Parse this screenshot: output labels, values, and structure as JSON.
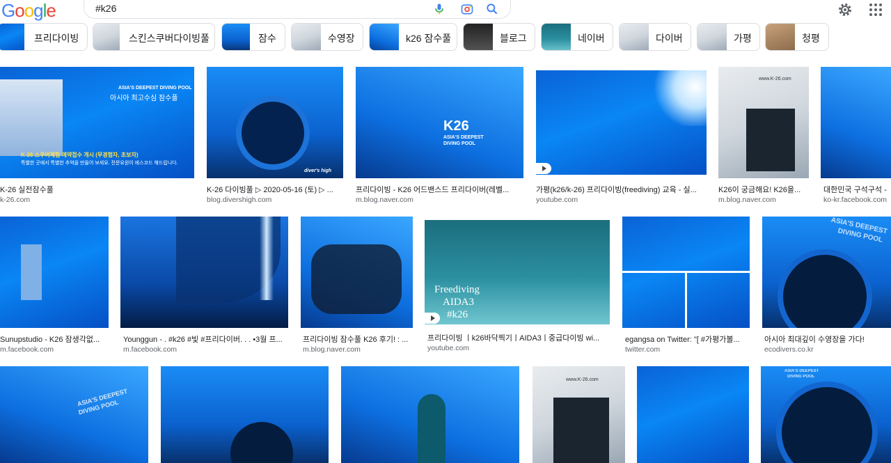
{
  "header": {
    "logo": [
      "G",
      "o",
      "o",
      "g",
      "l",
      "e"
    ],
    "logo_colors": [
      "#4285F4",
      "#EA4335",
      "#FBBC05",
      "#4285F4",
      "#34A853",
      "#EA4335"
    ],
    "query": "#k26",
    "mic_icon": "mic-icon",
    "lens_icon": "camera-lens-icon",
    "search_icon": "search-icon",
    "settings_icon": "gear-icon",
    "apps_icon": "apps-grid-icon"
  },
  "chips": [
    {
      "label": "프리다이빙"
    },
    {
      "label": "스킨스쿠버다이빙풀"
    },
    {
      "label": "잠수"
    },
    {
      "label": "수영장"
    },
    {
      "label": "k26 잠수풀"
    },
    {
      "label": "블로그"
    },
    {
      "label": "네이버"
    },
    {
      "label": "다이버"
    },
    {
      "label": "가평"
    },
    {
      "label": "청평"
    }
  ],
  "results": {
    "row1": [
      {
        "title": "K-26 실전잠수풀",
        "source": "k-26.com",
        "overlay": [
          "ASIA'S DEEPEST DIVING POOL",
          "아시아 최고수심 잠수풀",
          "K-26 스쿠버체험 예약접수 개시 (무경험자, 초보자)",
          "특별한 곳에서 특별한 추억을 만들어 보세요. 전문요원이 에스코드 해드립니다."
        ]
      },
      {
        "title": "K-26 다이빙풀 ▷ 2020-05-16 (토) ▷ ...",
        "source": "blog.divershigh.com",
        "overlay": [
          "diver's high"
        ]
      },
      {
        "title": "프리다이빙 - K26 어드밴스드 프리다이버(레벨...",
        "source": "m.blog.naver.com",
        "overlay": [
          "K26",
          "ASIA'S DEEPEST",
          "DIVING POOL"
        ]
      },
      {
        "title": "가평(k26/k-26) 프리다이빙(freediving) 교육 - 실...",
        "source": "youtube.com",
        "overlay": []
      },
      {
        "title": "K26이 궁금해요! K26을...",
        "source": "m.blog.naver.com",
        "overlay": [
          "www.K-26.com"
        ]
      },
      {
        "title": "대한민국 구석구석 -",
        "source": "ko-kr.facebook.com",
        "overlay": []
      }
    ],
    "row2": [
      {
        "title": "Sunupstudio - K26 잠생각없...",
        "source": "m.facebook.com",
        "overlay": []
      },
      {
        "title": "Younggun - . #k26 #빛 #프리다이버. . . •3월 프...",
        "source": "m.facebook.com",
        "overlay": []
      },
      {
        "title": "프리다이빙 잠수풀 K26 후기! : ...",
        "source": "m.blog.naver.com",
        "overlay": []
      },
      {
        "title": "프리다이빙 ㅣk26바닥찍기ㅣAIDA3ㅣ중급다이빙 wi...",
        "source": "youtube.com",
        "overlay": [
          "Freediving",
          "AIDA3",
          "#k26"
        ]
      },
      {
        "title": "egangsa on Twitter: \"[ #가평가볼...",
        "source": "twitter.com",
        "overlay": []
      },
      {
        "title": "아시아 최대깊이 수영장을 가다!",
        "source": "ecodivers.co.kr",
        "overlay": [
          "ASIA'S DEEPEST",
          "DIVING POOL"
        ]
      }
    ],
    "row3": [
      {
        "overlay": [
          "ASIA'S DEEPEST",
          "DIVING POOL"
        ]
      },
      {
        "overlay": []
      },
      {
        "overlay": []
      },
      {
        "overlay": [
          "www.K-26.com"
        ]
      },
      {
        "overlay": []
      },
      {
        "overlay": [
          "ASIA'S DEEPEST",
          "DIVING POOL"
        ]
      }
    ]
  }
}
